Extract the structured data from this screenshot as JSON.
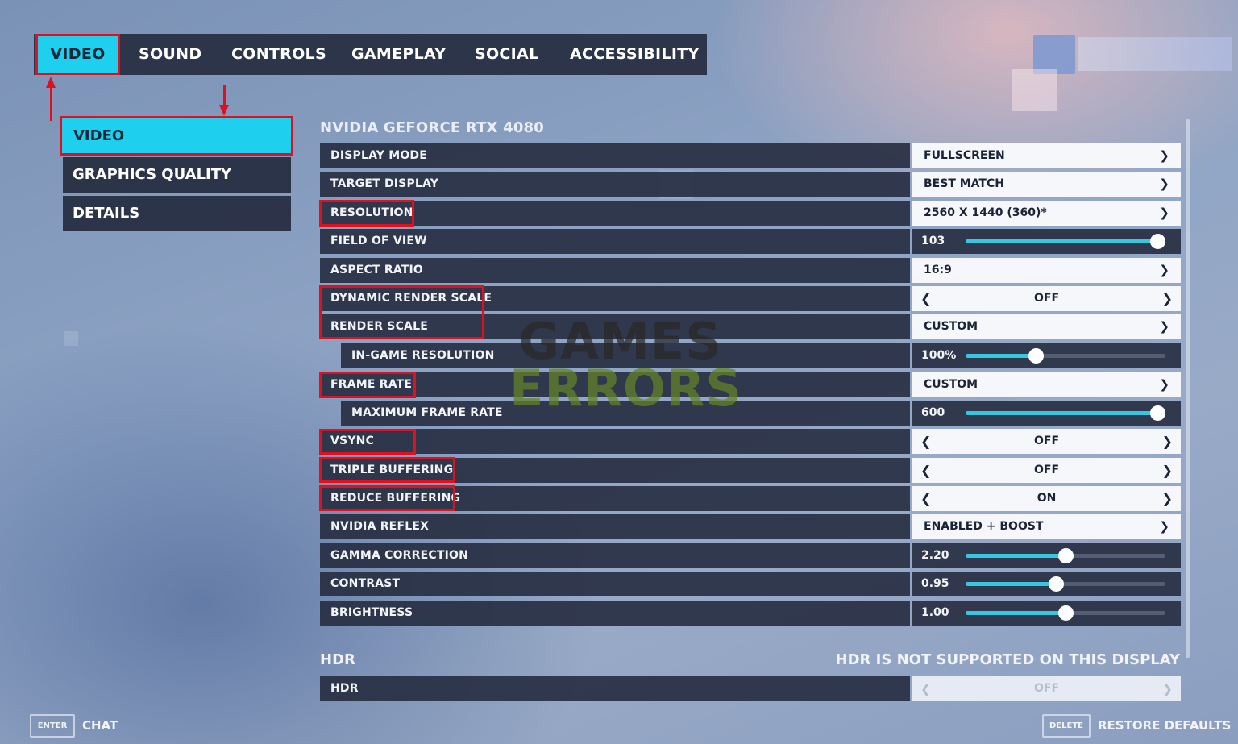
{
  "tabs": [
    {
      "label": "VIDEO"
    },
    {
      "label": "SOUND"
    },
    {
      "label": "CONTROLS"
    },
    {
      "label": "GAMEPLAY"
    },
    {
      "label": "SOCIAL"
    },
    {
      "label": "ACCESSIBILITY"
    }
  ],
  "submenu": [
    {
      "label": "VIDEO"
    },
    {
      "label": "GRAPHICS QUALITY"
    },
    {
      "label": "DETAILS"
    }
  ],
  "gpu_title": "NVIDIA GEFORCE RTX 4080",
  "settings": {
    "display_mode": {
      "label": "DISPLAY MODE",
      "value": "FULLSCREEN"
    },
    "target_display": {
      "label": "TARGET DISPLAY",
      "value": "BEST MATCH"
    },
    "resolution": {
      "label": "RESOLUTION",
      "value": "2560 X 1440 (360)*"
    },
    "field_of_view": {
      "label": "FIELD OF VIEW",
      "value": "103",
      "fraction": 0.96
    },
    "aspect_ratio": {
      "label": "ASPECT RATIO",
      "value": "16:9"
    },
    "dynamic_render_scale": {
      "label": "DYNAMIC RENDER SCALE",
      "value": "OFF"
    },
    "render_scale": {
      "label": "RENDER SCALE",
      "value": "CUSTOM"
    },
    "in_game_resolution": {
      "label": "IN-GAME RESOLUTION",
      "value": "100%",
      "fraction": 0.35
    },
    "frame_rate": {
      "label": "FRAME RATE",
      "value": "CUSTOM"
    },
    "maximum_frame_rate": {
      "label": "MAXIMUM FRAME RATE",
      "value": "600",
      "fraction": 0.96
    },
    "vsync": {
      "label": "VSYNC",
      "value": "OFF"
    },
    "triple_buffering": {
      "label": "TRIPLE BUFFERING",
      "value": "OFF"
    },
    "reduce_buffering": {
      "label": "REDUCE BUFFERING",
      "value": "ON"
    },
    "nvidia_reflex": {
      "label": "NVIDIA REFLEX",
      "value": "ENABLED + BOOST"
    },
    "gamma_correction": {
      "label": "GAMMA CORRECTION",
      "value": "2.20",
      "fraction": 0.5
    },
    "contrast": {
      "label": "CONTRAST",
      "value": "0.95",
      "fraction": 0.45
    },
    "brightness": {
      "label": "BRIGHTNESS",
      "value": "1.00",
      "fraction": 0.5
    }
  },
  "hdr": {
    "title": "HDR",
    "note": "HDR IS NOT SUPPORTED ON THIS DISPLAY",
    "label": "HDR",
    "value": "OFF"
  },
  "watermark": {
    "line1": "GAMES",
    "line2": "ERRORS"
  },
  "footer": {
    "enter_key": "ENTER",
    "chat": "CHAT",
    "delete_key": "DELETE",
    "restore": "RESTORE DEFAULTS"
  },
  "colors": {
    "accent": "#1fd0ee",
    "highlight_box": "#e0101e",
    "panel": "#262c40",
    "slider_fill": "#35c8de"
  }
}
